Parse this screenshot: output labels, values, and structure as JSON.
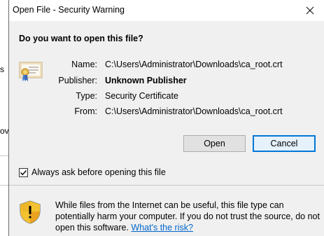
{
  "background": {
    "fragments": [
      "s",
      "ov"
    ]
  },
  "dialog": {
    "title": "Open File - Security Warning",
    "close_symbol": "✕",
    "question": "Do you want to open this file?",
    "fields": [
      {
        "label": "Name:",
        "value": "C:\\Users\\Administrator\\Downloads\\ca_root.crt",
        "bold": false
      },
      {
        "label": "Publisher:",
        "value": "Unknown Publisher",
        "bold": true
      },
      {
        "label": "Type:",
        "value": "Security Certificate",
        "bold": false
      },
      {
        "label": "From:",
        "value": "C:\\Users\\Administrator\\Downloads\\ca_root.crt",
        "bold": false
      }
    ],
    "open_button": "Open",
    "cancel_button": "Cancel",
    "always_ask": {
      "label": "Always ask before opening this file",
      "checked": true
    },
    "warning": {
      "text": "While files from the Internet can be useful, this file type can potentially harm your computer. If you do not trust the source, do not open this software. ",
      "link": "What's the risk?"
    },
    "icons": {
      "file_icon": "certificate-icon",
      "warning_icon": "security-shield-icon"
    },
    "colors": {
      "accent": "#0078d7",
      "link": "#0066cc",
      "dialog_bg": "#f0f0f0",
      "titlebar_bg": "#ffffff"
    }
  }
}
